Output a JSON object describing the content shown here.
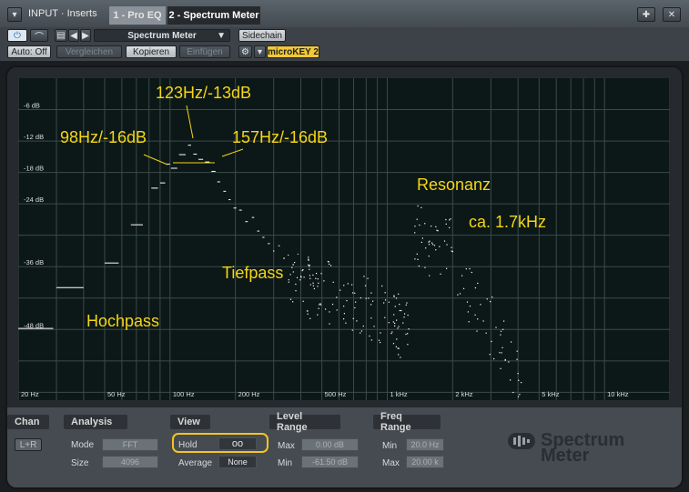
{
  "window": {
    "title": "INPUT · Inserts",
    "tabs": [
      "1 - Pro EQ",
      "2 - Spectrum Meter"
    ],
    "pin_icon": "pin-icon",
    "close_icon": "close-icon"
  },
  "toolbar": {
    "preset": "Spectrum Meter",
    "sidechain": "Sidechain",
    "auto": "Auto: Off",
    "compare": "Vergleichen",
    "copy": "Kopieren",
    "paste": "Einfügen",
    "device": "microKEY 2"
  },
  "plot": {
    "db_labels": [
      "-6 dB",
      "-12 dB",
      "-18 dB",
      "-24 dB",
      "-36 dB",
      "-48 dB"
    ],
    "db_values": [
      -6,
      -12,
      -18,
      -24,
      -36,
      -48
    ],
    "freq_labels": [
      "20 Hz",
      "50 Hz",
      "100 Hz",
      "200 Hz",
      "500 Hz",
      "1 kHz",
      "2 kHz",
      "5 kHz",
      "10 kHz"
    ],
    "freq_values": [
      20,
      50,
      100,
      200,
      500,
      1000,
      2000,
      5000,
      10000
    ],
    "annotations": {
      "peak": "123Hz/-13dB",
      "left": "98Hz/-16dB",
      "right": "157Hz/-16dB",
      "resonance": "Resonanz",
      "resonance_freq": "ca. 1.7kHz",
      "lowpass": "Tiefpass",
      "highpass": "Hochpass"
    },
    "colors": {
      "background": "#0c1817",
      "grid": "#3a4a48",
      "trace": "#ffffff",
      "annotation": "#f5d516"
    }
  },
  "controls": {
    "chan": {
      "title": "Chan",
      "value": "L+R"
    },
    "analysis": {
      "title": "Analysis",
      "mode_label": "Mode",
      "mode": "FFT",
      "size_label": "Size",
      "size": "4096"
    },
    "view": {
      "title": "View",
      "hold_label": "Hold",
      "hold": "oo",
      "average_label": "Average",
      "average": "None"
    },
    "level": {
      "title": "Level Range",
      "max_label": "Max",
      "max": "0.00 dB",
      "min_label": "Min",
      "min": "-61.50 dB"
    },
    "freq": {
      "title": "Freq Range",
      "min_label": "Min",
      "min": "20.0 Hz",
      "max_label": "Max",
      "max": "20.00 k"
    }
  },
  "brand": {
    "line1": "Spectrum",
    "line2": "Meter",
    "logo_icon": "presonus-logo-icon"
  }
}
